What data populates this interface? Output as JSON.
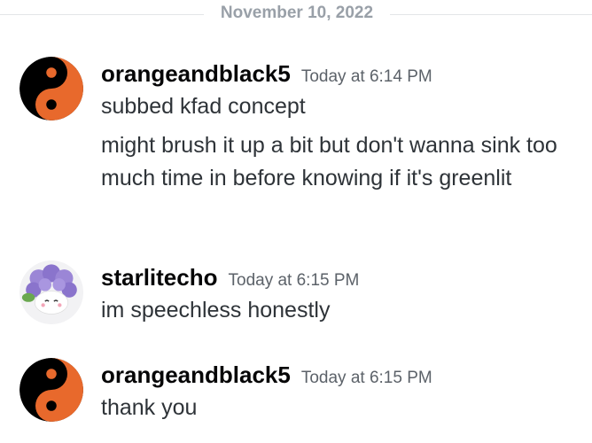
{
  "divider": {
    "date": "November 10, 2022"
  },
  "messages": [
    {
      "username": "orangeandblack5",
      "timestamp": "Today at 6:14 PM",
      "avatar_icon": "yin-yang-orange-icon",
      "lines": [
        "subbed kfad concept",
        "might brush it up a bit but don't wanna sink too much time in before knowing if it's greenlit"
      ]
    },
    {
      "username": "starlitecho",
      "timestamp": "Today at 6:15 PM",
      "avatar_icon": "purple-hydrangea-creature-icon",
      "lines": [
        "im speechless honestly"
      ]
    },
    {
      "username": "orangeandblack5",
      "timestamp": "Today at 6:15 PM",
      "avatar_icon": "yin-yang-orange-icon",
      "lines": [
        "thank you"
      ]
    }
  ],
  "colors": {
    "yin_yang_orange": "#e8692c",
    "yin_yang_black": "#000000",
    "username": "#060607",
    "timestamp": "#5c6269",
    "divider_text": "#99a0a8"
  }
}
